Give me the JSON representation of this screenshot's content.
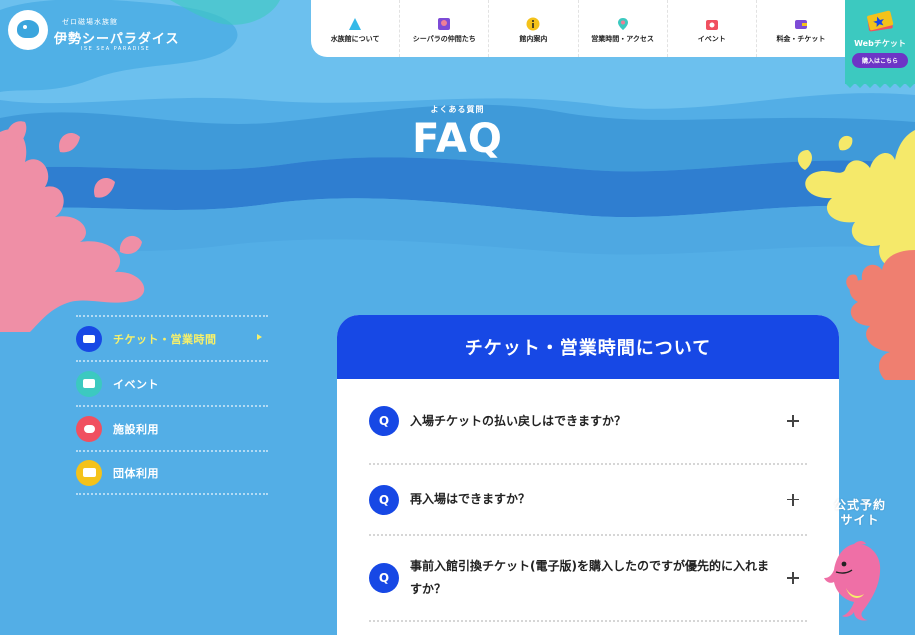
{
  "logo": {
    "sub": "ゼロ磁場水族館",
    "main": "伊勢シーパラダイス",
    "en": "ISE SEA PARADISE"
  },
  "nav": {
    "items": [
      {
        "label": "水族館について",
        "icon": "aquarium-icon",
        "color": "#35b9e8"
      },
      {
        "label": "シーパラの仲間たち",
        "icon": "friends-icon",
        "color": "#7d4bd6"
      },
      {
        "label": "館内案内",
        "icon": "info-icon",
        "color": "#f4c21a"
      },
      {
        "label": "営業時間・アクセス",
        "icon": "map-pin-icon",
        "color": "#3cc9c0"
      },
      {
        "label": "イベント",
        "icon": "camera-icon",
        "color": "#f05060"
      },
      {
        "label": "料金・チケット",
        "icon": "wallet-icon",
        "color": "#7d4bd6"
      }
    ]
  },
  "webticket": {
    "label": "Webチケット",
    "cta": "購入はこちら"
  },
  "hero": {
    "sub": "よくある質問",
    "title": "FAQ"
  },
  "sidebar": {
    "items": [
      {
        "label": "チケット・営業時間",
        "icon": "ticket-icon",
        "color": "#1748e5",
        "active": true
      },
      {
        "label": "イベント",
        "icon": "camera-icon",
        "color": "#3cc9c0",
        "active": false
      },
      {
        "label": "施設利用",
        "icon": "facility-icon",
        "color": "#f05060",
        "active": false
      },
      {
        "label": "団体利用",
        "icon": "bus-icon",
        "color": "#f4c21a",
        "active": false
      }
    ]
  },
  "faq": {
    "section_title": "チケット・営業時間について",
    "q_marker": "Q",
    "items": [
      {
        "question": "入場チケットの払い戻しはできますか？"
      },
      {
        "question": "再入場はできますか？"
      },
      {
        "question": "事前入館引換チケット(電子版)を購入したのですが優先的に入れますか？"
      }
    ]
  },
  "reserve": {
    "line1": "公式予約",
    "line2": "サイト"
  },
  "colors": {
    "accent_blue": "#1748e5",
    "sea": "#53aee6",
    "teal": "#3cc9c0",
    "highlight": "#f7f06a",
    "coral_pink": "#ef7f96",
    "coral_yellow": "#f5e96a"
  }
}
